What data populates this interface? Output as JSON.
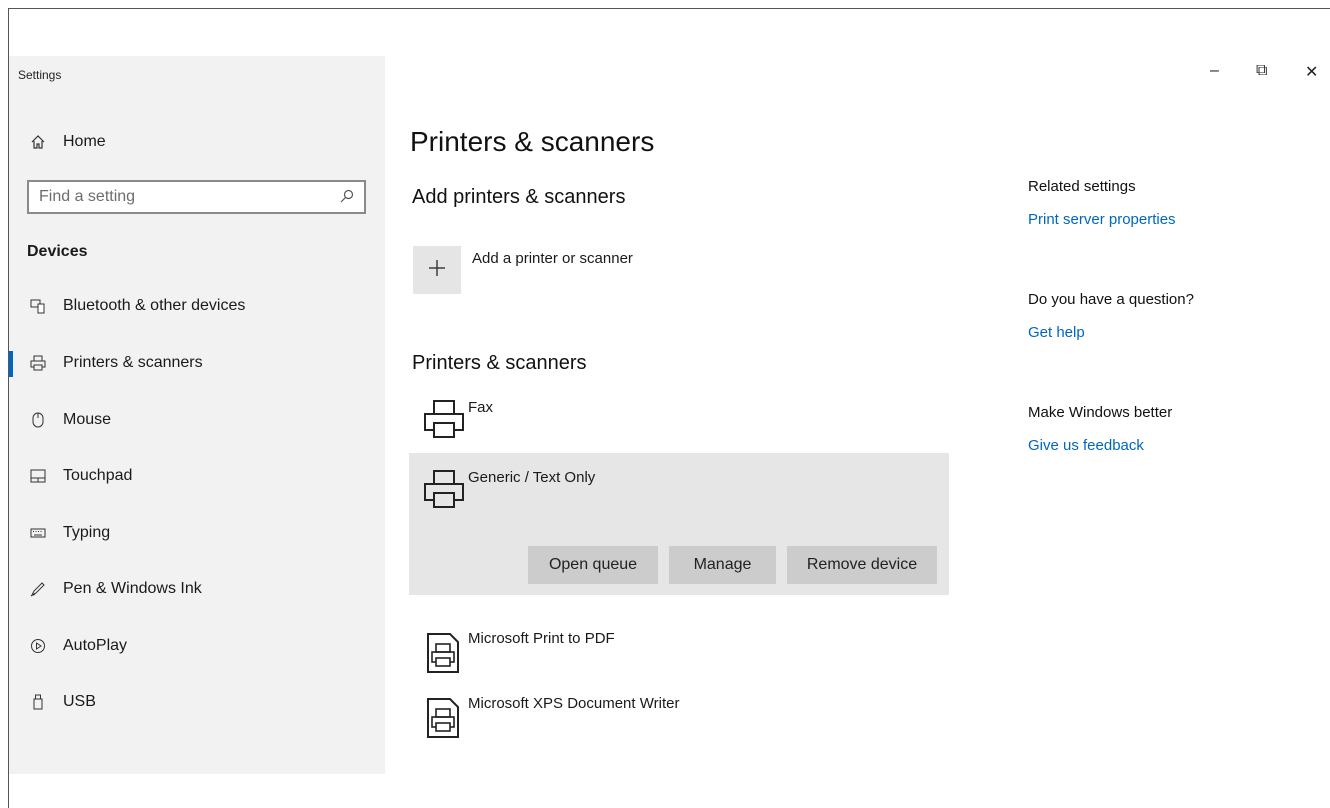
{
  "window": {
    "app_title": "Settings",
    "controls": {
      "minimize": "–",
      "restore": "⧉",
      "close": "✕"
    }
  },
  "sidebar": {
    "home_label": "Home",
    "search_placeholder": "Find a setting",
    "section_title": "Devices",
    "items": [
      {
        "label": "Bluetooth & other devices",
        "icon": "bluetooth-devices-icon"
      },
      {
        "label": "Printers & scanners",
        "icon": "printer-icon",
        "selected": true
      },
      {
        "label": "Mouse",
        "icon": "mouse-icon"
      },
      {
        "label": "Touchpad",
        "icon": "touchpad-icon"
      },
      {
        "label": "Typing",
        "icon": "keyboard-icon"
      },
      {
        "label": "Pen & Windows Ink",
        "icon": "pen-icon"
      },
      {
        "label": "AutoPlay",
        "icon": "autoplay-icon"
      },
      {
        "label": "USB",
        "icon": "usb-icon"
      }
    ]
  },
  "main": {
    "page_title": "Printers & scanners",
    "add_section_title": "Add printers & scanners",
    "add_label": "Add a printer or scanner",
    "list_section_title": "Printers & scanners",
    "devices": [
      {
        "name": "Fax",
        "icon": "printer-icon"
      },
      {
        "name": "Generic / Text Only",
        "icon": "printer-icon",
        "selected": true
      },
      {
        "name": "Microsoft Print to PDF",
        "icon": "document-printer-icon"
      },
      {
        "name": "Microsoft XPS Document Writer",
        "icon": "document-printer-icon"
      }
    ],
    "buttons": {
      "open_queue": "Open queue",
      "manage": "Manage",
      "remove": "Remove device"
    }
  },
  "related": {
    "related_heading": "Related settings",
    "print_server_link": "Print server properties",
    "question_heading": "Do you have a question?",
    "get_help_link": "Get help",
    "better_heading": "Make Windows better",
    "feedback_link": "Give us feedback"
  },
  "colors": {
    "accent": "#0067c0",
    "sidebar_bg": "#f2f2f2",
    "selected_bg": "#e6e6e6",
    "button_bg": "#cccccc"
  }
}
